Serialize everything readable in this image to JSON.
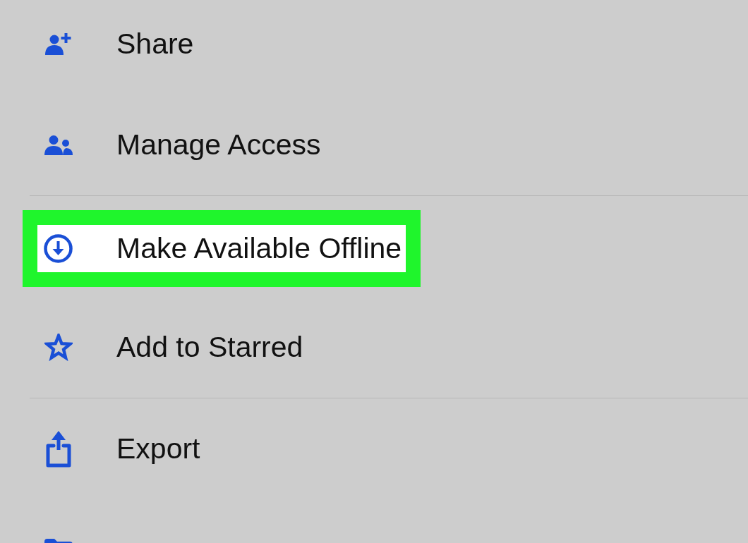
{
  "menu": {
    "groups": [
      {
        "items": [
          {
            "label": "Share",
            "kind": "share",
            "highlighted": false
          },
          {
            "label": "Manage Access",
            "kind": "access",
            "highlighted": false
          }
        ]
      },
      {
        "items": [
          {
            "label": "Make Available Offline",
            "kind": "offline",
            "highlighted": true
          },
          {
            "label": "Add to Starred",
            "kind": "star",
            "highlighted": false
          }
        ]
      },
      {
        "items": [
          {
            "label": "Export",
            "kind": "export",
            "highlighted": false
          },
          {
            "kind": "folder",
            "highlighted": false
          }
        ]
      }
    ]
  }
}
